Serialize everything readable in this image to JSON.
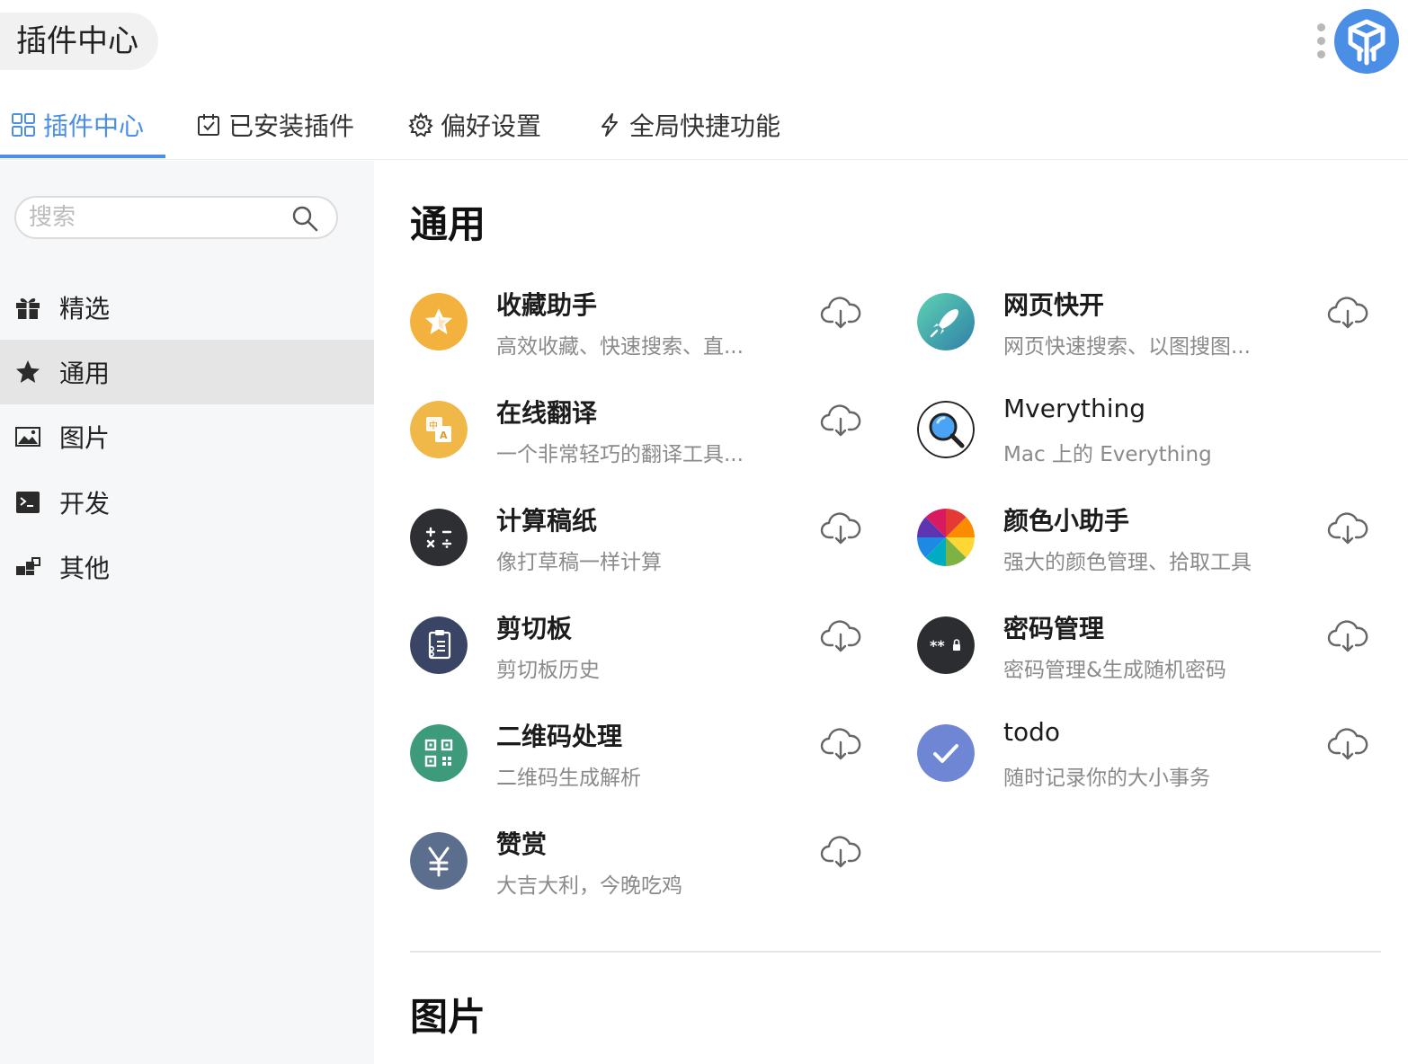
{
  "header": {
    "title": "插件中心"
  },
  "tabs": [
    {
      "label": "插件中心",
      "icon": "grid-icon",
      "active": true
    },
    {
      "label": "已安装插件",
      "icon": "calendar-check-icon",
      "active": false
    },
    {
      "label": "偏好设置",
      "icon": "gear-icon",
      "active": false
    },
    {
      "label": "全局快捷功能",
      "icon": "lightning-icon",
      "active": false
    }
  ],
  "search": {
    "placeholder": "搜索",
    "value": ""
  },
  "sidebar": {
    "items": [
      {
        "label": "精选",
        "icon": "gift-icon",
        "active": false
      },
      {
        "label": "通用",
        "icon": "star-icon",
        "active": true
      },
      {
        "label": "图片",
        "icon": "image-icon",
        "active": false
      },
      {
        "label": "开发",
        "icon": "terminal-icon",
        "active": false
      },
      {
        "label": "其他",
        "icon": "blocks-icon",
        "active": false
      }
    ]
  },
  "sections": [
    {
      "title": "通用",
      "plugins": [
        {
          "name": "收藏助手",
          "desc": "高效收藏、快速搜索、直...",
          "icon": "star-bookmark-icon",
          "color": "#f3b13d"
        },
        {
          "name": "网页快开",
          "desc": "网页快速搜索、以图搜图...",
          "icon": "rocket-icon",
          "color": "#3fb6a8"
        },
        {
          "name": "在线翻译",
          "desc": "一个非常轻巧的翻译工具...",
          "icon": "translate-icon",
          "color": "#f0b849"
        },
        {
          "name": "Mverything",
          "desc": "Mac 上的 Everything",
          "icon": "magnifier-icon",
          "color": "#3b8ee8"
        },
        {
          "name": "计算稿纸",
          "desc": "像打草稿一样计算",
          "icon": "calculator-icon",
          "color": "#2d2f33"
        },
        {
          "name": "颜色小助手",
          "desc": "强大的颜色管理、拾取工具",
          "icon": "color-wheel-icon",
          "color": "#e53935"
        },
        {
          "name": "剪切板",
          "desc": "剪切板历史",
          "icon": "clipboard-icon",
          "color": "#3a4566"
        },
        {
          "name": "密码管理",
          "desc": "密码管理&生成随机密码",
          "icon": "password-icon",
          "color": "#2b2d31"
        },
        {
          "name": "二维码处理",
          "desc": "二维码生成解析",
          "icon": "qrcode-icon",
          "color": "#3d9b7c"
        },
        {
          "name": "todo",
          "desc": "随时记录你的大小事务",
          "icon": "check-icon",
          "color": "#6e86d4"
        },
        {
          "name": "赞赏",
          "desc": "大吉大利，今晚吃鸡",
          "icon": "yen-icon",
          "color": "#5c6e8e"
        }
      ]
    },
    {
      "title": "图片"
    }
  ],
  "colors": {
    "accent": "#4a8ee5",
    "sidebar_bg": "#f6f7f9",
    "sidebar_active": "#e5e5e5"
  }
}
